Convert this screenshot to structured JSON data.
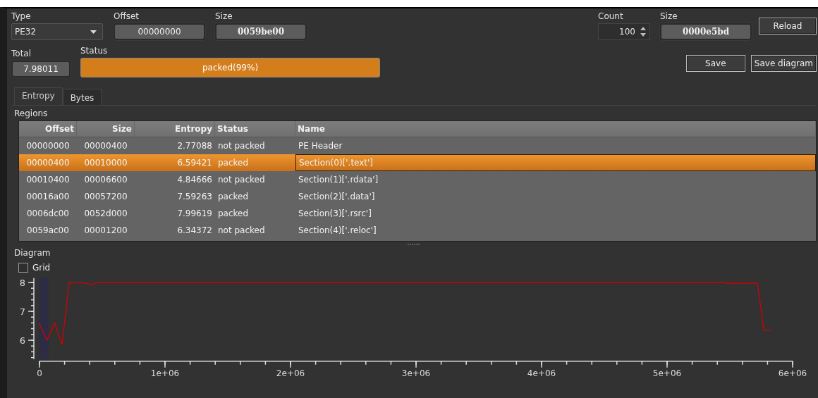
{
  "top": {
    "type": {
      "label": "Type",
      "value": "PE32"
    },
    "offset": {
      "label": "Offset",
      "value": "00000000"
    },
    "size": {
      "label": "Size",
      "value": "0059be00"
    },
    "count": {
      "label": "Count",
      "value": "100"
    },
    "block_size": {
      "label": "Size",
      "value": "0000e5bd"
    },
    "reload": "Reload"
  },
  "summary": {
    "total": {
      "label": "Total",
      "value": "7.98011"
    },
    "status": {
      "label": "Status",
      "value": "packed(99%)"
    },
    "buttons": [
      "Save",
      "Save diagram"
    ]
  },
  "tabs": [
    {
      "label": "Entropy",
      "selected": true
    },
    {
      "label": "Bytes",
      "selected": false
    }
  ],
  "regions": {
    "title": "Regions",
    "columns": [
      "Offset",
      "Size",
      "Entropy",
      "Status",
      "Name"
    ],
    "rows": [
      {
        "cells": [
          "00000000",
          "00000400",
          "2.77088",
          "not packed",
          "PE Header"
        ],
        "selected": false
      },
      {
        "cells": [
          "00000400",
          "00010000",
          "6.59421",
          "packed",
          "Section(0)['.text']"
        ],
        "selected": true
      },
      {
        "cells": [
          "00010400",
          "00006600",
          "4.84666",
          "not packed",
          "Section(1)['.rdata']"
        ],
        "selected": false
      },
      {
        "cells": [
          "00016a00",
          "00057200",
          "7.59263",
          "packed",
          "Section(2)['.data']"
        ],
        "selected": false
      },
      {
        "cells": [
          "0006dc00",
          "0052d000",
          "7.99619",
          "packed",
          "Section(3)['.rsrc']"
        ],
        "selected": false
      },
      {
        "cells": [
          "0059ac00",
          "00001200",
          "6.34372",
          "not packed",
          "Section(4)['.reloc']"
        ],
        "selected": false
      }
    ]
  },
  "diagram": {
    "title": "Diagram",
    "grid": {
      "label": "Grid",
      "checked": false
    },
    "chart_data": {
      "type": "line",
      "x": [
        0,
        60000,
        120000,
        180000,
        236000,
        363000,
        418000,
        460000,
        5445000,
        5470000,
        5550000,
        5620000,
        5690000,
        5720000,
        5770000,
        5830000
      ],
      "bands": [
        {
          "axis": "x",
          "from": 0,
          "to": 70000,
          "color": "#2c2c44"
        }
      ],
      "series": [
        {
          "color": "#d40000",
          "values": [
            6.56,
            6.0,
            6.6,
            5.85,
            8.0,
            7.98,
            7.92,
            8.0,
            8.0,
            7.97,
            7.98,
            7.97,
            7.98,
            7.98,
            6.35,
            6.35
          ]
        }
      ],
      "xlim": [
        0,
        6000000
      ],
      "ylim": [
        5.35,
        8.15
      ],
      "xticks": [
        {
          "value": 0,
          "label": "0"
        },
        {
          "value": 1000000,
          "label": "1e+06"
        },
        {
          "value": 2000000,
          "label": "2e+06"
        },
        {
          "value": 3000000,
          "label": "3e+06"
        },
        {
          "value": 4000000,
          "label": "4e+06"
        },
        {
          "value": 5000000,
          "label": "5e+06"
        },
        {
          "value": 6000000,
          "label": "6e+06"
        }
      ],
      "yticks": [
        6,
        7,
        8
      ]
    }
  }
}
